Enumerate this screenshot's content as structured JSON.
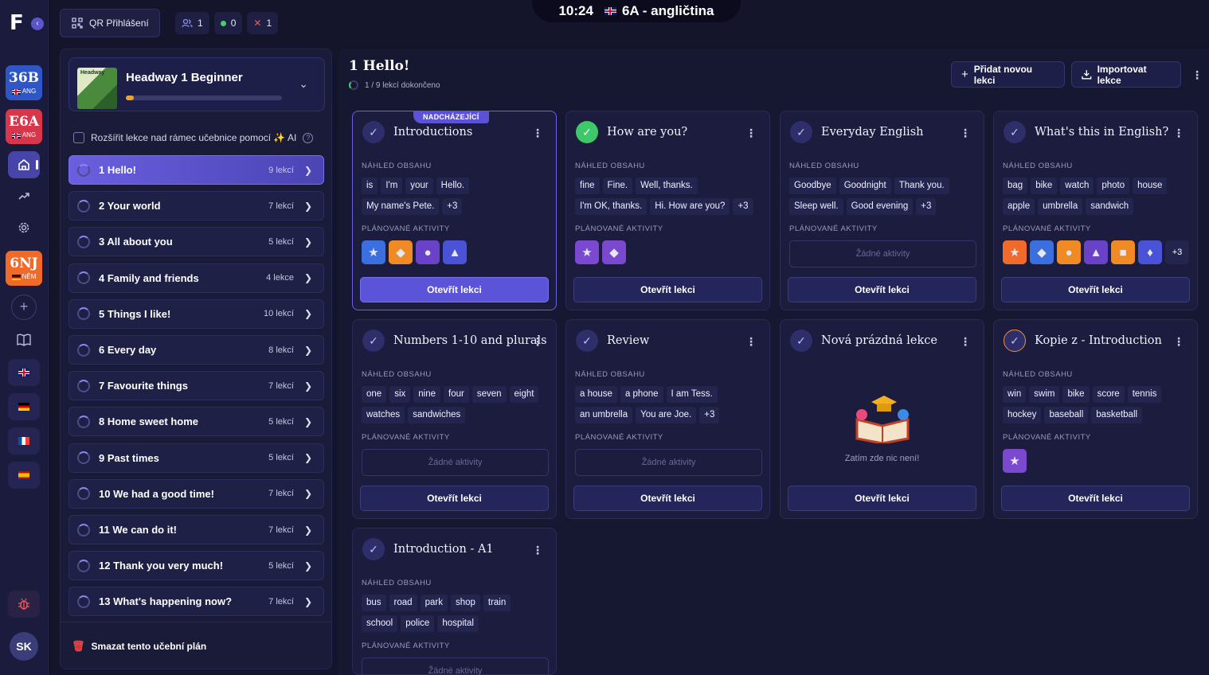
{
  "topbar": {
    "qr_label": "QR Přihlášení",
    "stats": [
      {
        "icon": "users-icon",
        "value": "1"
      },
      {
        "icon": "online-dot-icon",
        "value": "0"
      },
      {
        "icon": "x-icon",
        "value": "1"
      }
    ],
    "time": "10:24",
    "class_title": "6A - angličtina"
  },
  "rail": {
    "classes": [
      {
        "code": "36B",
        "lang": "ANG",
        "color": "#2f56c6"
      },
      {
        "code": "E6A",
        "lang": "ANG",
        "color": "#d8364a"
      },
      {
        "code": "6NJ",
        "lang": "NĚM",
        "color": "#f06a2a"
      }
    ],
    "avatar": "SK"
  },
  "sidebar": {
    "book_title": "Headway 1 Beginner",
    "book_cover_text": "Headway",
    "book_progress": 0.05,
    "ai_label": "Rozšířit lekce nad rámec učebnice pomocí ✨ AI",
    "units": [
      {
        "name": "1 Hello!",
        "count": "9 lekcí"
      },
      {
        "name": "2 Your world",
        "count": "7 lekcí"
      },
      {
        "name": "3 All about you",
        "count": "5 lekcí"
      },
      {
        "name": "4 Family and friends",
        "count": "4 lekce"
      },
      {
        "name": "5 Things I like!",
        "count": "10 lekcí"
      },
      {
        "name": "6 Every day",
        "count": "8 lekcí"
      },
      {
        "name": "7 Favourite things",
        "count": "7 lekcí"
      },
      {
        "name": "8 Home sweet home",
        "count": "5 lekcí"
      },
      {
        "name": "9 Past times",
        "count": "5 lekcí"
      },
      {
        "name": "10 We had a good time!",
        "count": "7 lekcí"
      },
      {
        "name": "11 We can do it!",
        "count": "7 lekcí"
      },
      {
        "name": "12 Thank you very much!",
        "count": "5 lekcí"
      },
      {
        "name": "13 What's happening now?",
        "count": "7 lekcí"
      }
    ],
    "delete_label": "Smazat tento učební plán"
  },
  "main": {
    "title": "1 Hello!",
    "subtitle": "1 / 9 lekcí dokončeno",
    "add_label": "Přidat novou lekci",
    "import_label": "Importovat lekce",
    "preview_label": "NÁHLED OBSAHU",
    "planned_label": "PLÁNOVANÉ AKTIVITY",
    "no_activities": "Žádné aktivity",
    "open_label": "Otevřít lekci",
    "upcoming_badge": "NADCHÁZEJÍCÍ",
    "empty_text": "Zatím zde nic není!",
    "lessons": [
      {
        "title": "Introductions",
        "tags": [
          "is",
          "I'm",
          "your",
          "Hello.",
          "My name's Pete.",
          "+3"
        ],
        "activities": [
          "#3b6fe0",
          "#f08a24",
          "#6a42c8",
          "#4a52d8"
        ],
        "more": ""
      },
      {
        "title": "How are you?",
        "tags": [
          "fine",
          "Fine.",
          "Well, thanks.",
          "I'm OK, thanks.",
          "Hi. How are you?",
          "+3"
        ],
        "activities": [
          "#7b48d0",
          "#7b48d0"
        ],
        "more": ""
      },
      {
        "title": "Everyday English",
        "tags": [
          "Goodbye",
          "Goodnight",
          "Thank you.",
          "Sleep well.",
          "Good evening",
          "+3"
        ],
        "activities": [],
        "more": ""
      },
      {
        "title": "What's this in English?",
        "tags": [
          "bag",
          "bike",
          "watch",
          "photo",
          "house",
          "apple",
          "umbrella",
          "sandwich"
        ],
        "activities": [
          "#f06a2a",
          "#3b6fe0",
          "#f08a24",
          "#6a42c8",
          "#f08a24",
          "#4a52d8"
        ],
        "more": "+3"
      },
      {
        "title": "Numbers 1-10 and plurals",
        "tags": [
          "one",
          "six",
          "nine",
          "four",
          "seven",
          "eight",
          "watches",
          "sandwiches"
        ],
        "activities": [],
        "more": ""
      },
      {
        "title": "Review",
        "tags": [
          "a house",
          "a phone",
          "I am Tess.",
          "an umbrella",
          "You are Joe.",
          "+3"
        ],
        "activities": [],
        "more": ""
      },
      {
        "title": "Nová prázdná lekce",
        "tags": [],
        "activities": [],
        "more": ""
      },
      {
        "title": "Kopie z - Introduction",
        "tags": [
          "win",
          "swim",
          "bike",
          "score",
          "tennis",
          "hockey",
          "baseball",
          "basketball"
        ],
        "activities": [
          "#7b48d0"
        ],
        "more": ""
      },
      {
        "title": "Introduction - A1",
        "tags": [
          "bus",
          "road",
          "park",
          "shop",
          "train",
          "school",
          "police",
          "hospital"
        ],
        "activities": [],
        "more": ""
      }
    ]
  }
}
